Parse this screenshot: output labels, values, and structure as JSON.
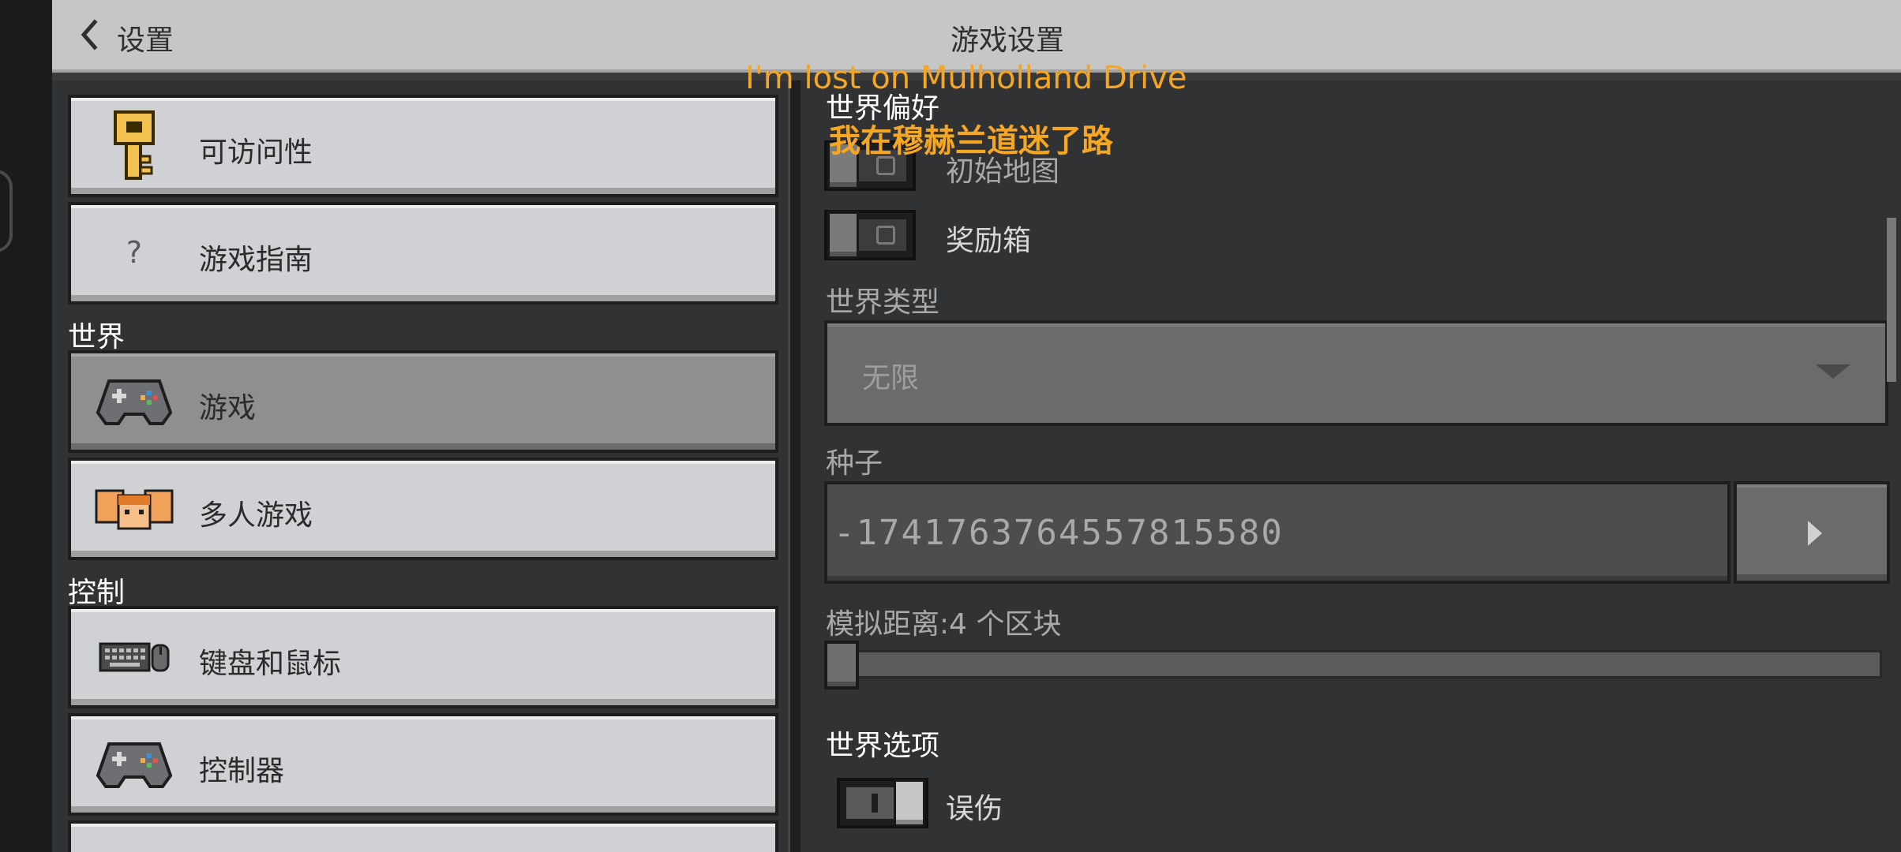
{
  "header": {
    "back_label": "设置",
    "title": "游戏设置"
  },
  "sidebar": {
    "items": [
      {
        "label": "可访问性",
        "icon": "key-icon"
      },
      {
        "label": "游戏指南",
        "icon": "question-icon"
      },
      {
        "label": "游戏",
        "icon": "gamepad-icon",
        "active": true
      },
      {
        "label": "多人游戏",
        "icon": "players-icon"
      },
      {
        "label": "键盘和鼠标",
        "icon": "keyboard-mouse-icon"
      },
      {
        "label": "控制器",
        "icon": "controller-icon"
      }
    ],
    "sections": {
      "world": "世界",
      "controls": "控制"
    }
  },
  "settings": {
    "world_prefs_heading": "世界偏好",
    "starter_map_label": "初始地图",
    "bonus_chest_label": "奖励箱",
    "world_type_label": "世界类型",
    "world_type_value": "无限",
    "seed_label": "种子",
    "seed_value": "-1741763764557815580",
    "sim_distance_label": "模拟距离:4 个区块",
    "sim_distance_value": 4,
    "world_options_heading": "世界选项",
    "friendly_fire_label": "误伤",
    "friendly_fire_on": true,
    "starter_map_on": false,
    "bonus_chest_on": false
  },
  "subtitles": {
    "english": "I'm lost on Mulholland Drive",
    "chinese": "我在穆赫兰道迷了路"
  },
  "colors": {
    "subtitle": "#f5a623",
    "header_bg": "#c6c6c6",
    "pane_bg": "#313233"
  }
}
